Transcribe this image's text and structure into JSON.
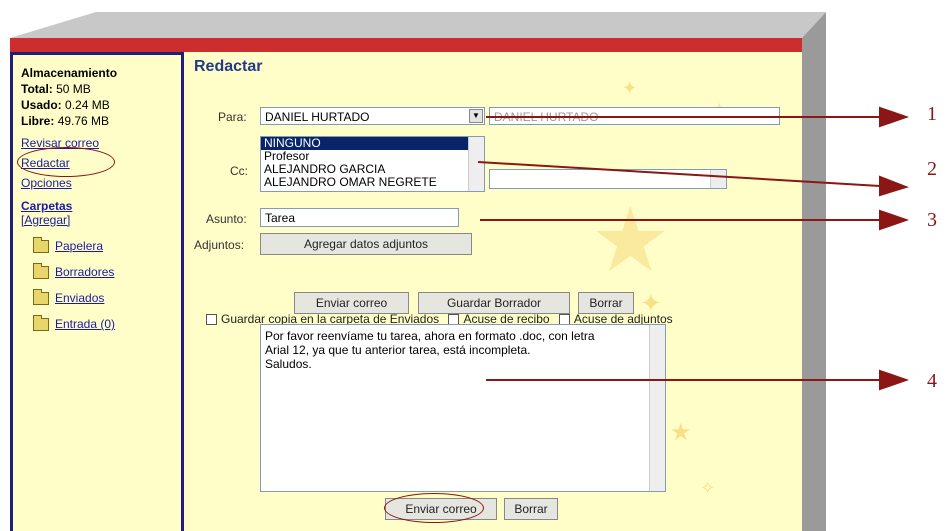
{
  "sidebar": {
    "storage_title": "Almacenamiento",
    "total_label": "Total:",
    "total_value": "50 MB",
    "used_label": "Usado:",
    "used_value": "0.24 MB",
    "free_label": "Libre:",
    "free_value": "49.76 MB",
    "links": [
      "Revisar correo",
      "Redactar",
      "Opciones"
    ],
    "folders_title": "Carpetas",
    "add_label": "[Agregar]",
    "folders": [
      "Papelera",
      "Borradores",
      "Enviados",
      "Entrada (0)"
    ]
  },
  "compose": {
    "title": "Redactar",
    "to_label": "Para:",
    "to_value": "DANIEL HURTADO",
    "to_text": "DANIEL HURTADO",
    "cc_label": "Cc:",
    "cc_options": [
      "NINGUNO",
      "Profesor",
      "ALEJANDRO GARCIA",
      "ALEJANDRO OMAR NEGRETE"
    ],
    "subject_label": "Asunto:",
    "subject_value": "Tarea",
    "attach_label": "Adjuntos:",
    "attach_button": "Agregar datos adjuntos",
    "save_copy_label": "Guardar copia en la carpeta de Enviados",
    "receipt_label": "Acuse de recibo",
    "attach_receipt_label": "Acuse de adjuntos",
    "send_button": "Enviar correo",
    "save_draft_button": "Guardar Borrador",
    "delete_button": "Borrar",
    "body_lines": [
      "Por favor reenvíame tu tarea, ahora en formato .doc, con letra",
      "Arial 12, ya que tu anterior tarea, está incompleta.",
      "Saludos."
    ],
    "send_button_bottom": "Enviar correo",
    "delete_button_bottom": "Borrar"
  },
  "callouts": [
    "1",
    "2",
    "3",
    "4"
  ],
  "colors": {
    "header_red": "#cc2d2d",
    "panel_bg": "#fffec8",
    "annotation": "#8a1616",
    "title_blue": "#223a8a"
  }
}
